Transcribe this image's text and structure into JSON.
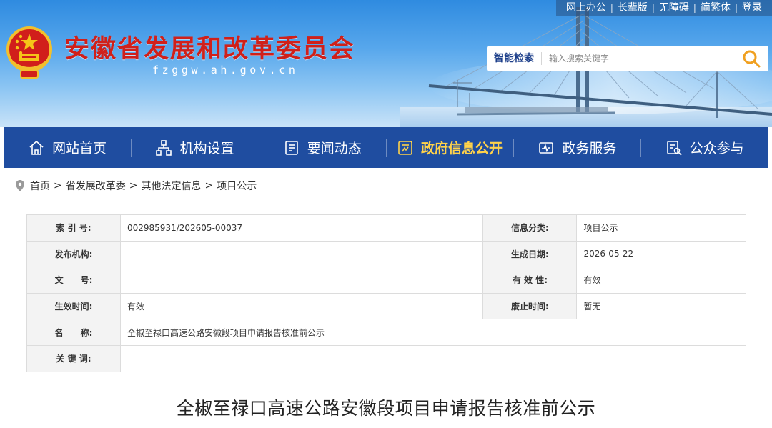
{
  "topbar": {
    "links": [
      "网上办公",
      "长辈版",
      "无障碍",
      "简繁体",
      "登录"
    ]
  },
  "header": {
    "site_title": "安徽省发展和改革委员会",
    "site_domain": "fzggw.ah.gov.cn",
    "emblem_icon": "national-emblem-icon"
  },
  "search": {
    "label": "智能检索",
    "placeholder": "输入搜索关键字",
    "button_icon": "search-icon"
  },
  "nav": {
    "items": [
      {
        "label": "网站首页",
        "icon": "home-icon",
        "active": false
      },
      {
        "label": "机构设置",
        "icon": "org-chart-icon",
        "active": false
      },
      {
        "label": "要闻动态",
        "icon": "news-icon",
        "active": false
      },
      {
        "label": "政府信息公开",
        "icon": "info-disclosure-icon",
        "active": true
      },
      {
        "label": "政务服务",
        "icon": "service-icon",
        "active": false
      },
      {
        "label": "公众参与",
        "icon": "participation-icon",
        "active": false
      }
    ]
  },
  "breadcrumb": {
    "icon": "location-pin-icon",
    "items": [
      "首页",
      "省发展改革委",
      "其他法定信息",
      "项目公示"
    ],
    "separator": ">"
  },
  "meta": {
    "index_no_label": "索 引 号:",
    "index_no": "002985931/202605-00037",
    "category_label": "信息分类:",
    "category": "项目公示",
    "publisher_label": "发布机构:",
    "publisher": "",
    "date_label": "生成日期:",
    "date": "2026-05-22",
    "doc_no_label": "文　　号:",
    "doc_no": "",
    "validity_label": "有 效 性:",
    "validity": "有效",
    "effective_label": "生效时间:",
    "effective": "有效",
    "expiry_label": "废止时间:",
    "expiry": "暂无",
    "name_label": "名　　称:",
    "name": "全椒至禄口高速公路安徽段项目申请报告核准前公示",
    "keywords_label": "关 键 词:",
    "keywords": ""
  },
  "article": {
    "title": "全椒至禄口高速公路安徽段项目申请报告核准前公示"
  },
  "colors": {
    "nav_bg": "#1f4da0",
    "nav_active": "#ffd24a",
    "title_red": "#d0201a",
    "label_bg": "#f3f3f3"
  }
}
